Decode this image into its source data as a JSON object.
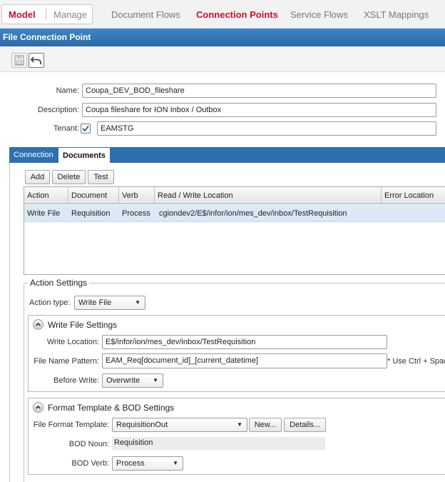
{
  "nav": {
    "model": "Model",
    "manage": "Manage",
    "links": [
      "Document Flows",
      "Connection Points",
      "Service Flows",
      "XSLT Mappings"
    ]
  },
  "title": "File Connection Point",
  "form": {
    "name_label": "Name:",
    "name_value": "Coupa_DEV_BOD_fileshare",
    "description_label": "Description:",
    "description_value": "Coupa fileshare for ION Inbox / Outbox",
    "tenant_label": "Tenant:",
    "tenant_checked": true,
    "tenant_value": "EAMSTG"
  },
  "tabs": [
    "Connection",
    "Documents"
  ],
  "grid_buttons": [
    "Add",
    "Delete",
    "Test"
  ],
  "grid": {
    "columns": [
      "Action",
      "Document",
      "Verb",
      "Read / Write Location",
      "Error Location"
    ],
    "rows": [
      [
        "Write File",
        "Requisition",
        "Process",
        "cgiondev2/E$/infor/ion/mes_dev/inbox/TestRequisition",
        ""
      ]
    ]
  },
  "action_settings": {
    "legend": "Action Settings",
    "action_type_label": "Action type:",
    "action_type_value": "Write File"
  },
  "write_file": {
    "title": "Write File Settings",
    "write_location_label": "Write Location:",
    "write_location_value": "E$/infor/ion/mes_dev/inbox/TestRequisition",
    "pattern_label": "File Name Pattern:",
    "pattern_value": "EAM_Req[document_id]_[current_datetime]",
    "pattern_note": "* Use Ctrl + Spac",
    "before_write_label": "Before Write:",
    "before_write_value": "Overwrite"
  },
  "format": {
    "title": "Format Template & BOD Settings",
    "template_label": "File Format Template:",
    "template_value": "RequisitionOut",
    "new_button": "New...",
    "details_button": "Details...",
    "noun_label": "BOD Noun:",
    "noun_value": "Requisition",
    "verb_label": "BOD Verb:",
    "verb_value": "Process"
  }
}
